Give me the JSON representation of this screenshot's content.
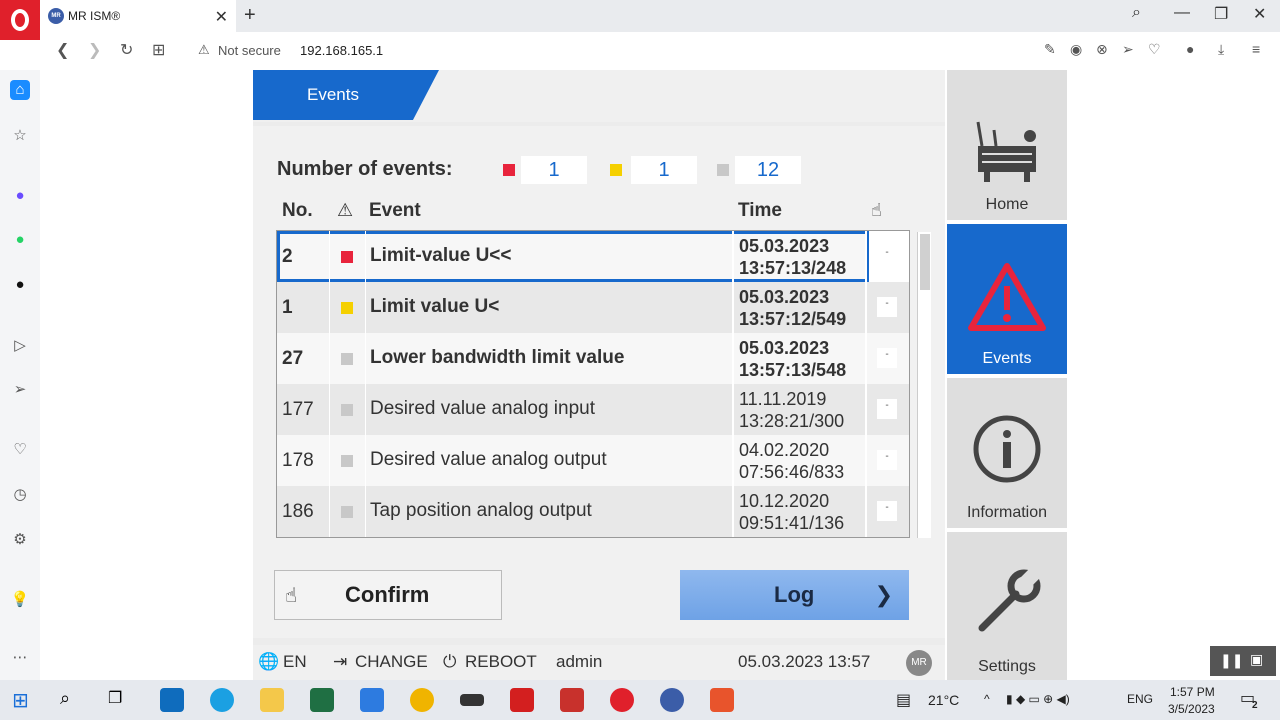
{
  "browser": {
    "tab_title": "MR ISM®",
    "tab_favicon": "MR",
    "new_tab": "+",
    "security_label": "Not secure",
    "url": "192.168.165.1"
  },
  "hmi": {
    "section_title": "Events",
    "number_of_events_label": "Number of events:",
    "counts": {
      "red": "1",
      "yellow": "1",
      "gray": "12"
    },
    "columns": {
      "no": "No.",
      "event": "Event",
      "time": "Time"
    },
    "rows": [
      {
        "no": "2",
        "severity": "#e8243c",
        "event": "Limit-value U<<",
        "date": "05.03.2023",
        "time": "13:57:13/248",
        "bold": true,
        "selected": true,
        "ack": "-"
      },
      {
        "no": "1",
        "severity": "#f5d000",
        "event": "Limit value U<",
        "date": "05.03.2023",
        "time": "13:57:12/549",
        "bold": true,
        "selected": false,
        "ack": "-"
      },
      {
        "no": "27",
        "severity": "#c8c8c8",
        "event": "Lower bandwidth limit value",
        "date": "05.03.2023",
        "time": "13:57:13/548",
        "bold": true,
        "selected": false,
        "ack": "-"
      },
      {
        "no": "177",
        "severity": "#c8c8c8",
        "event": "Desired value analog input",
        "date": "11.11.2019",
        "time": "13:28:21/300",
        "bold": false,
        "selected": false,
        "ack": "-"
      },
      {
        "no": "178",
        "severity": "#c8c8c8",
        "event": "Desired value analog output",
        "date": "04.02.2020",
        "time": "07:56:46/833",
        "bold": false,
        "selected": false,
        "ack": "-"
      },
      {
        "no": "186",
        "severity": "#c8c8c8",
        "event": "Tap position analog output",
        "date": "10.12.2020",
        "time": "09:51:41/136",
        "bold": false,
        "selected": false,
        "ack": "-"
      }
    ],
    "confirm_label": "Confirm",
    "log_label": "Log",
    "status": {
      "language": "EN",
      "change": "CHANGE",
      "reboot": "REBOOT",
      "user": "admin",
      "datetime": "05.03.2023 13:57",
      "logo": "MR"
    },
    "nav": [
      {
        "label": "Home",
        "icon": "transformer-icon"
      },
      {
        "label": "Events",
        "icon": "warning-triangle-icon"
      },
      {
        "label": "Information",
        "icon": "info-circle-icon"
      },
      {
        "label": "Settings",
        "icon": "wrench-icon"
      }
    ]
  },
  "taskbar": {
    "temperature": "21°C",
    "language": "ENG",
    "time": "1:57 PM",
    "date": "3/5/2023",
    "notifications": "2"
  },
  "colors": {
    "accent": "#1769cc",
    "red": "#e8243c",
    "yellow": "#f5d000",
    "gray": "#c8c8c8"
  }
}
